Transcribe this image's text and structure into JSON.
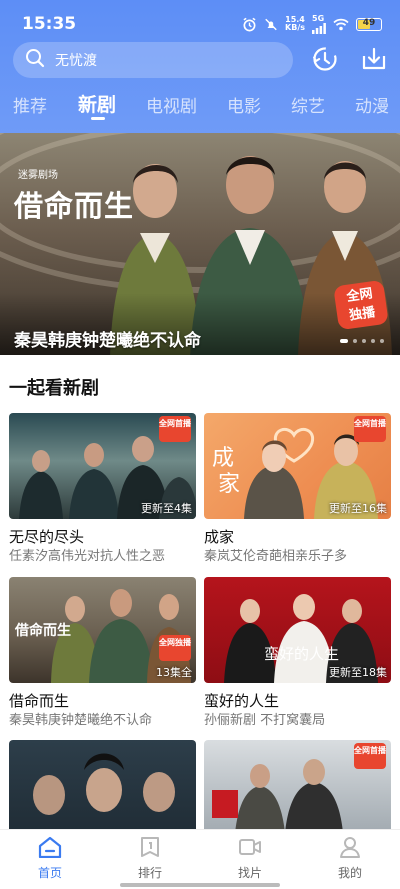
{
  "status_bar": {
    "time": "15:35",
    "net_speed_value": "15.4",
    "net_speed_unit": "KB/s",
    "signal_label": "5G",
    "battery": "49"
  },
  "search": {
    "placeholder": "无忧渡"
  },
  "top_icons": [
    "download-history-icon",
    "download-icon"
  ],
  "tabs": [
    {
      "label": "推荐",
      "active": false
    },
    {
      "label": "新剧",
      "active": true
    },
    {
      "label": "电视剧",
      "active": false
    },
    {
      "label": "电影",
      "active": false
    },
    {
      "label": "综艺",
      "active": false
    },
    {
      "label": "动漫",
      "active": false
    }
  ],
  "banner": {
    "studio": "迷雾剧场",
    "title_art": "借命而生",
    "caption": "秦昊韩庚钟楚曦绝不认命",
    "badge": "全网独播",
    "slides": 5,
    "active_slide": 0
  },
  "section": {
    "title": "一起看新剧"
  },
  "cards": [
    {
      "title": "无尽的尽头",
      "desc": "任素汐高伟光对抗人性之恶",
      "label": "更新至4集",
      "badge": "全网首播"
    },
    {
      "title": "成家",
      "desc": "秦岚艾伦奇葩相亲乐子多",
      "label": "更新至16集",
      "badge": "全网首播"
    },
    {
      "title": "借命而生",
      "desc": "秦昊韩庚钟楚曦绝不认命",
      "label": "13集全",
      "badge": "全网独播"
    },
    {
      "title": "蛮好的人生",
      "desc": "孙俪新剧 不打窝囊局",
      "label": "更新至18集",
      "badge": ""
    },
    {
      "title": "",
      "desc": "",
      "label": "",
      "badge": ""
    },
    {
      "title": "",
      "desc": "",
      "label": "",
      "badge": "全网首播"
    }
  ],
  "bottom_nav": [
    {
      "label": "首页",
      "icon": "home-icon",
      "active": true
    },
    {
      "label": "排行",
      "icon": "ranking-icon",
      "active": false
    },
    {
      "label": "找片",
      "icon": "video-search-icon",
      "active": false
    },
    {
      "label": "我的",
      "icon": "profile-icon",
      "active": false
    }
  ],
  "colors": {
    "header": "#5d8ef6",
    "accent": "#3b7bf0",
    "badge": "#e8462f"
  }
}
